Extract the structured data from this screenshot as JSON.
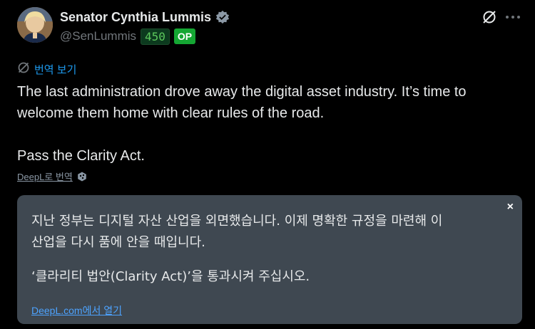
{
  "author": {
    "name": "Senator Cynthia Lummis",
    "handle": "@SenLummis",
    "score": "450",
    "op_badge": "OP",
    "verified_icon": "verified-badge-icon",
    "colors": {
      "verified": "#8b98a5",
      "score_text": "#5cc85c",
      "score_bg": "#0c3a1e",
      "op_bg": "#15a633"
    }
  },
  "actions": {
    "grok_icon": "grok-icon",
    "more_icon": "more-icon"
  },
  "translate": {
    "label": "번역 보기",
    "icon": "translate-icon"
  },
  "tweet": {
    "line1": "The last administration drove away the digital asset industry. It’s time to",
    "line2": "welcome them home with clear rules of the road.",
    "line3": "Pass the Clarity Act."
  },
  "deepl": {
    "label": "DeepL로 번역",
    "icon": "deepl-icon"
  },
  "translation_box": {
    "close": "×",
    "line1": "지난 정부는 디지털 자산 산업을 외면했습니다. 이제 명확한 규정을 마련해 이",
    "line2": "산업을 다시 품에 안을 때입니다.",
    "line3": "‘클라리티 법안(Clarity Act)’을 통과시켜 주십시오.",
    "link": "DeepL.com에서 열기"
  }
}
